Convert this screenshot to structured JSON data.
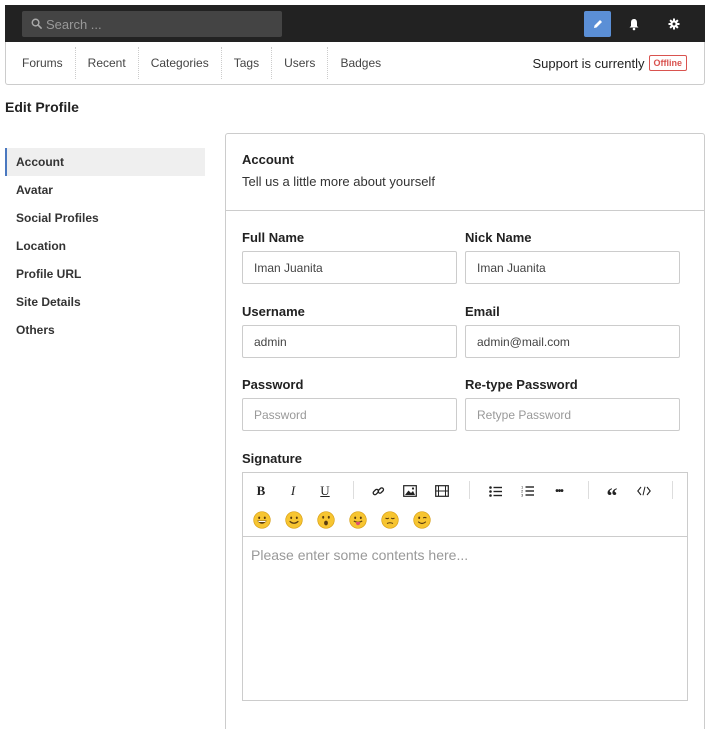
{
  "topbar": {
    "search_placeholder": "Search ..."
  },
  "nav": {
    "links": [
      "Forums",
      "Recent",
      "Categories",
      "Tags",
      "Users",
      "Badges"
    ],
    "support_text": "Support is currently",
    "support_status": "Offline"
  },
  "page_title": "Edit Profile",
  "sidebar": {
    "items": [
      "Account",
      "Avatar",
      "Social Profiles",
      "Location",
      "Profile URL",
      "Site Details",
      "Others"
    ],
    "active": "Account"
  },
  "panel": {
    "title": "Account",
    "subtitle": "Tell us a little more about yourself"
  },
  "form": {
    "full_name": {
      "label": "Full Name",
      "value": "Iman Juanita"
    },
    "nick_name": {
      "label": "Nick Name",
      "value": "Iman Juanita"
    },
    "username": {
      "label": "Username",
      "value": "admin"
    },
    "email": {
      "label": "Email",
      "value": "admin@mail.com"
    },
    "password": {
      "label": "Password",
      "placeholder": "Password"
    },
    "retype_password": {
      "label": "Re-type Password",
      "placeholder": "Retype Password"
    },
    "signature": {
      "label": "Signature",
      "placeholder": "Please enter some contents here..."
    }
  },
  "toolbar": {
    "bold": "B",
    "italic": "I",
    "underline": "U",
    "more": "•••",
    "quote": "“"
  },
  "colors": {
    "accent": "#5b8fd6",
    "offline": "#d9534f",
    "topbar": "#222222"
  }
}
